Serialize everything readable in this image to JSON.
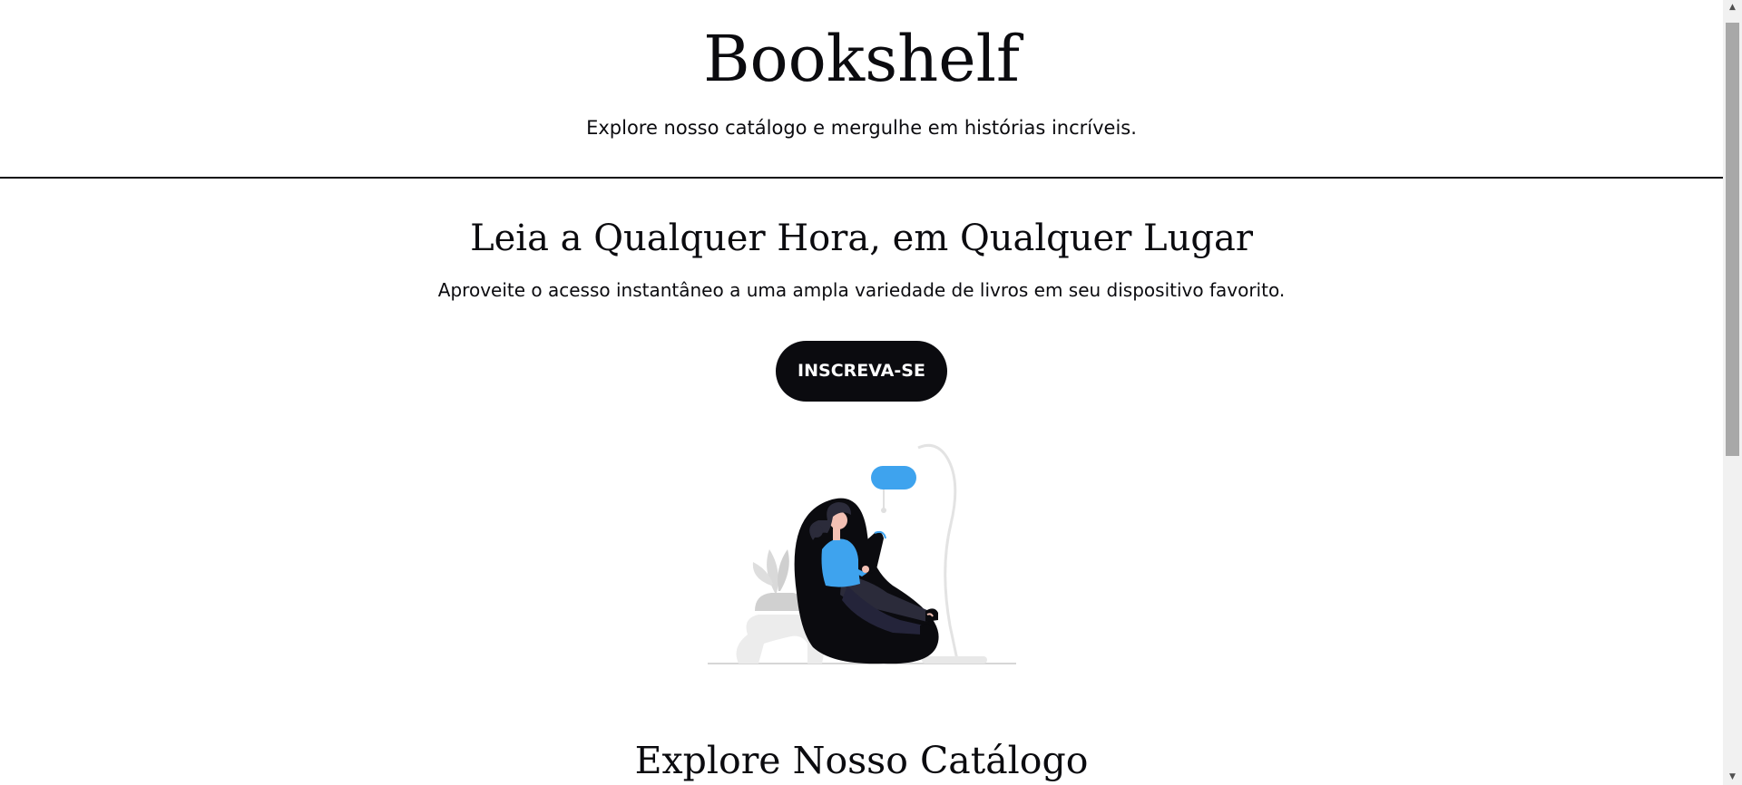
{
  "header": {
    "title": "Bookshelf",
    "subtitle": "Explore nosso catálogo e mergulhe em histórias incríveis."
  },
  "hero": {
    "title": "Leia a Qualquer Hora, em Qualquer Lugar",
    "text": "Aproveite o acesso instantâneo a uma ampla variedade de livros em seu dispositivo favorito.",
    "cta_label": "INSCREVA-SE",
    "illustration_icon": "woman-reading-on-beanbag-illustration"
  },
  "catalog": {
    "title": "Explore Nosso Catálogo"
  },
  "scrollbar": {
    "up_icon": "▲",
    "down_icon": "▼"
  },
  "colors": {
    "text": "#0b0b0f",
    "button_bg": "#0b0b0f",
    "button_text": "#ffffff",
    "accent_blue": "#3ea3ee",
    "scroll_track": "#f1f1f1",
    "scroll_thumb": "#a8a8a8"
  }
}
